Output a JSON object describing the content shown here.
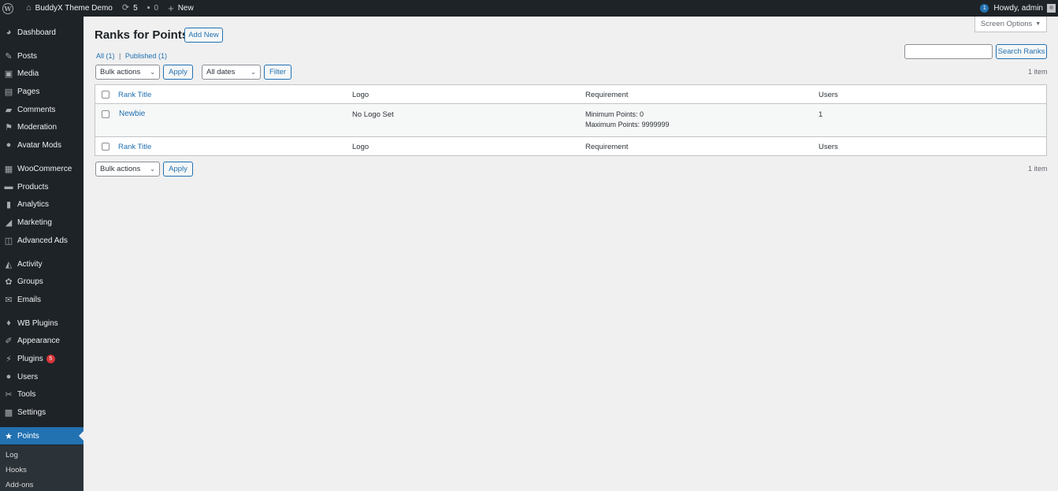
{
  "adminbar": {
    "site_name": "BuddyX Theme Demo",
    "updates_count": "5",
    "comments_count": "0",
    "new_label": "New",
    "notification_count": "1",
    "howdy": "Howdy, admin"
  },
  "sidebar": {
    "items": [
      {
        "label": "Dashboard",
        "icon": "dashboard-icon"
      },
      {
        "label": "Posts",
        "icon": "pin-icon"
      },
      {
        "label": "Media",
        "icon": "media-icon"
      },
      {
        "label": "Pages",
        "icon": "page-icon"
      },
      {
        "label": "Comments",
        "icon": "comment-icon"
      },
      {
        "label": "Moderation",
        "icon": "flag-icon"
      },
      {
        "label": "Avatar Mods",
        "icon": "user-icon"
      },
      {
        "label": "WooCommerce",
        "icon": "woo-icon"
      },
      {
        "label": "Products",
        "icon": "archive-icon"
      },
      {
        "label": "Analytics",
        "icon": "bar-chart-icon"
      },
      {
        "label": "Marketing",
        "icon": "megaphone-icon"
      },
      {
        "label": "Advanced Ads",
        "icon": "ads-icon"
      },
      {
        "label": "Activity",
        "icon": "activity-icon"
      },
      {
        "label": "Groups",
        "icon": "groups-icon"
      },
      {
        "label": "Emails",
        "icon": "email-icon"
      },
      {
        "label": "WB Plugins",
        "icon": "bulb-icon"
      },
      {
        "label": "Appearance",
        "icon": "brush-icon"
      },
      {
        "label": "Plugins",
        "icon": "plugin-icon",
        "badge": "5"
      },
      {
        "label": "Users",
        "icon": "users-icon"
      },
      {
        "label": "Tools",
        "icon": "wrench-icon"
      },
      {
        "label": "Settings",
        "icon": "settings-icon"
      },
      {
        "label": "Points",
        "icon": "star-icon"
      }
    ],
    "submenu": [
      "Log",
      "Hooks",
      "Add-ons"
    ]
  },
  "page": {
    "title": "Ranks for Points",
    "add_new": "Add New",
    "screen_options": "Screen Options",
    "filter_all": "All",
    "filter_all_count": "(1)",
    "filter_sep": "|",
    "filter_published": "Published",
    "filter_published_count": "(1)",
    "search_button": "Search Ranks",
    "bulk_actions": "Bulk actions",
    "apply": "Apply",
    "all_dates": "All dates",
    "filter_button": "Filter",
    "item_count": "1 item"
  },
  "table": {
    "columns": [
      "Rank Title",
      "Logo",
      "Requirement",
      "Users"
    ],
    "rows": [
      {
        "title": "Newbie",
        "logo": "No Logo Set",
        "min": "Minimum Points: 0",
        "max": "Maximum Points: 9999999",
        "users": "1"
      }
    ]
  }
}
